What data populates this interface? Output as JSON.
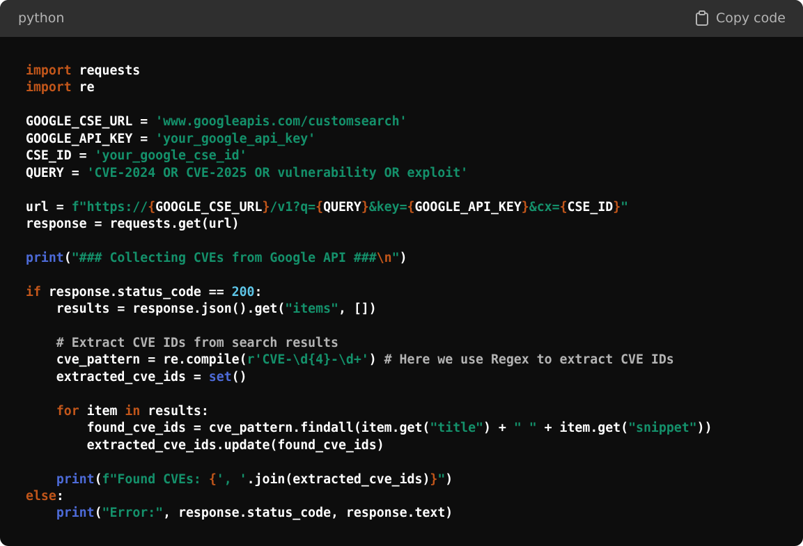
{
  "header": {
    "language": "python",
    "copy_label": "Copy code",
    "copy_icon": "clipboard-icon"
  },
  "colors": {
    "header_bg": "#2f2f2f",
    "code_bg": "#0d0d0d",
    "keyword": "#c2561a",
    "builtin": "#4d6bd8",
    "string": "#14916b",
    "number": "#5ec6e8",
    "comment": "#b4b4b4"
  },
  "code_lines": [
    [
      {
        "t": "import",
        "c": "kw"
      },
      {
        "t": " requests"
      }
    ],
    [
      {
        "t": "import",
        "c": "kw"
      },
      {
        "t": " re"
      }
    ],
    [],
    [
      {
        "t": "GOOGLE_CSE_URL = "
      },
      {
        "t": "'www.googleapis.com/customsearch'",
        "c": "str"
      }
    ],
    [
      {
        "t": "GOOGLE_API_KEY = "
      },
      {
        "t": "'your_google_api_key'",
        "c": "str"
      }
    ],
    [
      {
        "t": "CSE_ID = "
      },
      {
        "t": "'your_google_cse_id'",
        "c": "str"
      }
    ],
    [
      {
        "t": "QUERY = "
      },
      {
        "t": "'CVE-2024 OR CVE-2025 OR vulnerability OR exploit'",
        "c": "str"
      }
    ],
    [],
    [
      {
        "t": "url = "
      },
      {
        "t": "f\"https://",
        "c": "str"
      },
      {
        "t": "{",
        "c": "ip"
      },
      {
        "t": "GOOGLE_CSE_URL"
      },
      {
        "t": "}",
        "c": "ip"
      },
      {
        "t": "/v1?q=",
        "c": "str"
      },
      {
        "t": "{",
        "c": "ip"
      },
      {
        "t": "QUERY"
      },
      {
        "t": "}",
        "c": "ip"
      },
      {
        "t": "&key=",
        "c": "str"
      },
      {
        "t": "{",
        "c": "ip"
      },
      {
        "t": "GOOGLE_API_KEY"
      },
      {
        "t": "}",
        "c": "ip"
      },
      {
        "t": "&cx=",
        "c": "str"
      },
      {
        "t": "{",
        "c": "ip"
      },
      {
        "t": "CSE_ID"
      },
      {
        "t": "}",
        "c": "ip"
      },
      {
        "t": "\"",
        "c": "str"
      }
    ],
    [
      {
        "t": "response = requests.get(url)"
      }
    ],
    [],
    [
      {
        "t": "print",
        "c": "fn"
      },
      {
        "t": "("
      },
      {
        "t": "\"### Collecting CVEs from Google API ###",
        "c": "str"
      },
      {
        "t": "\\n",
        "c": "kw"
      },
      {
        "t": "\"",
        "c": "str"
      },
      {
        "t": ")"
      }
    ],
    [],
    [
      {
        "t": "if",
        "c": "kw"
      },
      {
        "t": " response.status_code == "
      },
      {
        "t": "200",
        "c": "num"
      },
      {
        "t": ":"
      }
    ],
    [
      {
        "t": "    results = response.json().get("
      },
      {
        "t": "\"items\"",
        "c": "str"
      },
      {
        "t": ", [])"
      }
    ],
    [],
    [
      {
        "t": "    # Extract CVE IDs from search results",
        "c": "com"
      }
    ],
    [
      {
        "t": "    cve_pattern = re.compile("
      },
      {
        "t": "r'CVE-\\d{4}-\\d+'",
        "c": "str"
      },
      {
        "t": ") "
      },
      {
        "t": "# Here we use Regex to extract CVE IDs",
        "c": "com"
      }
    ],
    [
      {
        "t": "    extracted_cve_ids = "
      },
      {
        "t": "set",
        "c": "fn"
      },
      {
        "t": "()"
      }
    ],
    [],
    [
      {
        "t": "    "
      },
      {
        "t": "for",
        "c": "kw"
      },
      {
        "t": " item "
      },
      {
        "t": "in",
        "c": "kw"
      },
      {
        "t": " results:"
      }
    ],
    [
      {
        "t": "        found_cve_ids = cve_pattern.findall(item.get("
      },
      {
        "t": "\"title\"",
        "c": "str"
      },
      {
        "t": ") + "
      },
      {
        "t": "\" \"",
        "c": "str"
      },
      {
        "t": " + item.get("
      },
      {
        "t": "\"snippet\"",
        "c": "str"
      },
      {
        "t": "))"
      }
    ],
    [
      {
        "t": "        extracted_cve_ids.update(found_cve_ids)"
      }
    ],
    [],
    [
      {
        "t": "    "
      },
      {
        "t": "print",
        "c": "fn"
      },
      {
        "t": "("
      },
      {
        "t": "f\"Found CVEs: ",
        "c": "str"
      },
      {
        "t": "{",
        "c": "ip"
      },
      {
        "t": "', '",
        "c": "str"
      },
      {
        "t": ".join(extracted_cve_ids)"
      },
      {
        "t": "}",
        "c": "ip"
      },
      {
        "t": "\"",
        "c": "str"
      },
      {
        "t": ")"
      }
    ],
    [
      {
        "t": "else",
        "c": "kw"
      },
      {
        "t": ":"
      }
    ],
    [
      {
        "t": "    "
      },
      {
        "t": "print",
        "c": "fn"
      },
      {
        "t": "("
      },
      {
        "t": "\"Error:\"",
        "c": "str"
      },
      {
        "t": ", response.status_code, response.text)"
      }
    ]
  ]
}
